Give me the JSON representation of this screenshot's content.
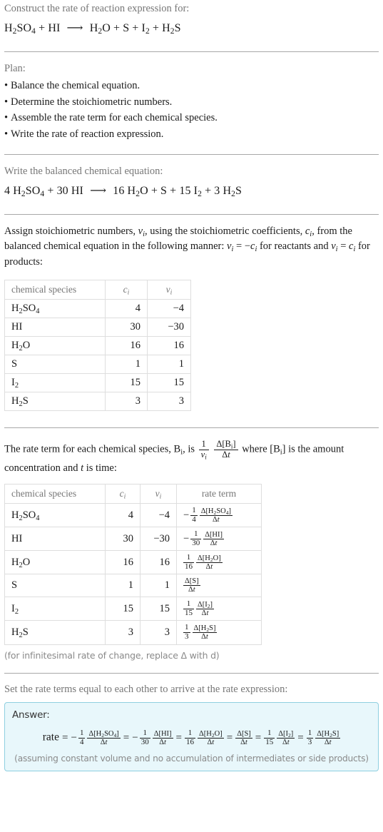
{
  "prompt": {
    "title": "Construct the rate of reaction expression for:",
    "equation_plain": "H_2SO_4 + HI  ⟶  H_2O + S + I_2 + H_2S"
  },
  "plan": {
    "heading": "Plan:",
    "steps": [
      "Balance the chemical equation.",
      "Determine the stoichiometric numbers.",
      "Assemble the rate term for each chemical species.",
      "Write the rate of reaction expression."
    ]
  },
  "balanced": {
    "heading": "Write the balanced chemical equation:",
    "equation_plain": "4 H_2SO_4 + 30 HI  ⟶  16 H_2O + S + 15 I_2 + 3 H_2S",
    "reactants": [
      {
        "coefficient": "4",
        "formula": "H2SO4"
      },
      {
        "coefficient": "30",
        "formula": "HI"
      }
    ],
    "products": [
      {
        "coefficient": "16",
        "formula": "H2O"
      },
      {
        "coefficient": "",
        "formula": "S"
      },
      {
        "coefficient": "15",
        "formula": "I2"
      },
      {
        "coefficient": "3",
        "formula": "H2S"
      }
    ]
  },
  "assign": {
    "paragraph_plain": "Assign stoichiometric numbers, ν_i, using the stoichiometric coefficients, c_i, from the balanced chemical equation in the following manner: ν_i = -c_i for reactants and ν_i = c_i for products:"
  },
  "stoich_table": {
    "headers": [
      "chemical species",
      "c_i",
      "ν_i"
    ],
    "rows": [
      {
        "species": "H2SO4",
        "c": "4",
        "nu": "-4"
      },
      {
        "species": "HI",
        "c": "30",
        "nu": "-30"
      },
      {
        "species": "H2O",
        "c": "16",
        "nu": "16"
      },
      {
        "species": "S",
        "c": "1",
        "nu": "1"
      },
      {
        "species": "I2",
        "c": "15",
        "nu": "15"
      },
      {
        "species": "H2S",
        "c": "3",
        "nu": "3"
      }
    ]
  },
  "rate_term_intro": {
    "paragraph_plain": "The rate term for each chemical species, B_i, is (1/ν_i)(Δ[B_i]/Δt) where [B_i] is the amount concentration and t is time:"
  },
  "rate_table": {
    "headers": [
      "chemical species",
      "c_i",
      "ν_i",
      "rate term"
    ],
    "rows": [
      {
        "species": "H2SO4",
        "c": "4",
        "nu": "-4",
        "sign": "-",
        "coef_num": "1",
        "coef_den": "4",
        "delta": "Δ[H2SO4]",
        "dt": "Δt"
      },
      {
        "species": "HI",
        "c": "30",
        "nu": "-30",
        "sign": "-",
        "coef_num": "1",
        "coef_den": "30",
        "delta": "Δ[HI]",
        "dt": "Δt"
      },
      {
        "species": "H2O",
        "c": "16",
        "nu": "16",
        "sign": "",
        "coef_num": "1",
        "coef_den": "16",
        "delta": "Δ[H2O]",
        "dt": "Δt"
      },
      {
        "species": "S",
        "c": "1",
        "nu": "1",
        "sign": "",
        "coef_num": "",
        "coef_den": "",
        "delta": "Δ[S]",
        "dt": "Δt"
      },
      {
        "species": "I2",
        "c": "15",
        "nu": "15",
        "sign": "",
        "coef_num": "1",
        "coef_den": "15",
        "delta": "Δ[I2]",
        "dt": "Δt"
      },
      {
        "species": "H2S",
        "c": "3",
        "nu": "3",
        "sign": "",
        "coef_num": "1",
        "coef_den": "3",
        "delta": "Δ[H2S]",
        "dt": "Δt"
      }
    ]
  },
  "footnote": "(for infinitesimal rate of change, replace Δ with d)",
  "final": {
    "heading": "Set the rate terms equal to each other to arrive at the rate expression:",
    "answer_label": "Answer:",
    "rate_label": "rate",
    "expression_plain": "rate = -1/4 Δ[H2SO4]/Δt = -1/30 Δ[HI]/Δt = 1/16 Δ[H2O]/Δt = Δ[S]/Δt = 1/15 Δ[I2]/Δt = 1/3 Δ[H2S]/Δt",
    "note": "(assuming constant volume and no accumulation of intermediates or side products)"
  },
  "colors": {
    "answer_box_background": "#e8f7fb",
    "answer_box_border": "#8fcfe0",
    "gray_text": "#767676",
    "table_border": "#dedede",
    "divider": "#a8a8a8"
  }
}
